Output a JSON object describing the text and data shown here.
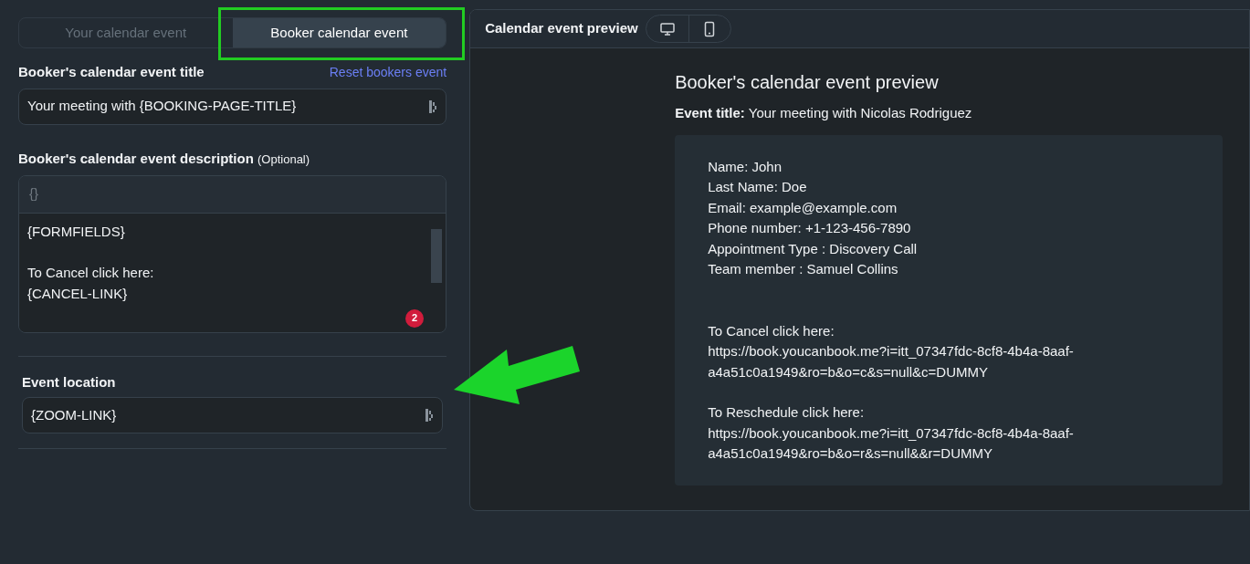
{
  "tabs": [
    {
      "label": "Your calendar event",
      "selected": false
    },
    {
      "label": "Booker calendar event",
      "selected": true
    }
  ],
  "title_field": {
    "label": "Booker's calendar event title",
    "reset_link": "Reset bookers event",
    "value": "Your meeting with {BOOKING-PAGE-TITLE}"
  },
  "description_field": {
    "label": "Booker's calendar event description",
    "optional": "(Optional)",
    "toolbar_button": "{}",
    "badge": "2",
    "paragraphs": [
      [
        "{FORMFIELDS}"
      ],
      [
        "To Cancel click here:",
        "{CANCEL-LINK}"
      ]
    ]
  },
  "location_field": {
    "label": "Event location",
    "value": "{ZOOM-LINK}"
  },
  "preview": {
    "header": "Calendar event preview",
    "view_buttons": [
      {
        "kind": "desktop"
      },
      {
        "kind": "mobile"
      }
    ],
    "heading": "Booker's calendar event preview",
    "event_title_label": "Event title:",
    "event_title_value": "Your meeting with Nicolas Rodriguez",
    "paragraphs": [
      [
        "Name: John",
        "Last Name: Doe",
        "Email: example@example.com",
        "Phone number: +1-123-456-7890",
        "Appointment Type : Discovery Call",
        "Team member : Samuel Collins"
      ],
      [
        "To Cancel click here:",
        "https://book.youcanbook.me?i=itt_07347fdc-8cf8-4b4a-8aaf-",
        "a4a51c0a1949&ro=b&o=c&s=null&c=DUMMY"
      ],
      [
        "To Reschedule click here:",
        "https://book.youcanbook.me?i=itt_07347fdc-8cf8-4b4a-8aaf-",
        "a4a51c0a1949&ro=b&o=r&s=null&&r=DUMMY"
      ]
    ]
  },
  "annotations": {
    "highlight": true,
    "arrow": true
  }
}
